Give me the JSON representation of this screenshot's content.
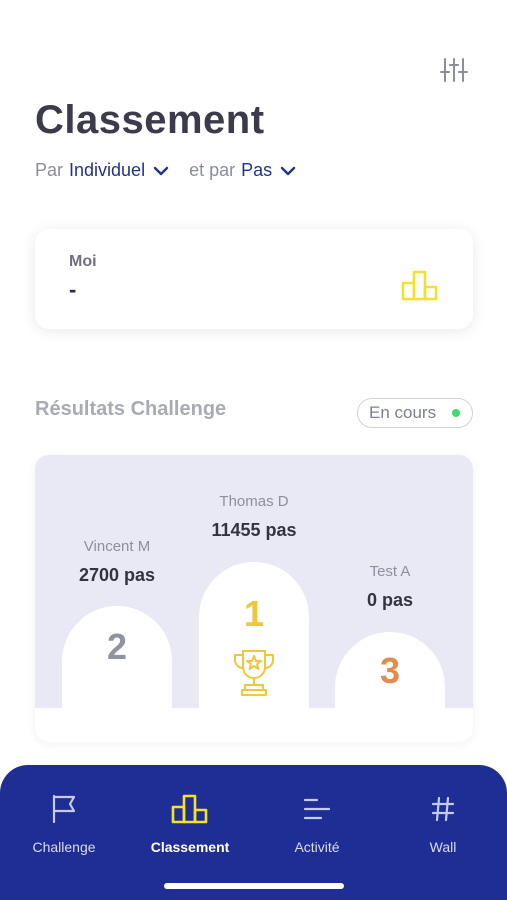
{
  "header": {
    "title": "Classement",
    "filter_icon": "sliders-icon"
  },
  "filters": {
    "prefix1": "Par",
    "value1": "Individuel",
    "prefix2": "et par",
    "value2": "Pas"
  },
  "me": {
    "label": "Moi",
    "value": "-",
    "icon": "podium-icon"
  },
  "results": {
    "title": "Résultats Challenge",
    "status": "En cours",
    "status_color": "#3ddc70"
  },
  "podium": {
    "first": {
      "name": "Thomas D",
      "score": "11455 pas",
      "rank": "1",
      "rank_color": "#f0c63a",
      "icon": "trophy-icon"
    },
    "second": {
      "name": "Vincent M",
      "score": "2700 pas",
      "rank": "2",
      "rank_color": "#8e949e"
    },
    "third": {
      "name": "Test A",
      "score": "0 pas",
      "rank": "3",
      "rank_color": "#e48a4a"
    }
  },
  "nav": {
    "items": [
      {
        "label": "Challenge",
        "icon": "flag-icon"
      },
      {
        "label": "Classement",
        "icon": "podium-icon",
        "active": true
      },
      {
        "label": "Activité",
        "icon": "lines-icon"
      },
      {
        "label": "Wall",
        "icon": "hash-icon"
      }
    ]
  },
  "colors": {
    "accent": "#24318f",
    "nav_bg": "#1e2e95",
    "highlight": "#f5e12a"
  }
}
